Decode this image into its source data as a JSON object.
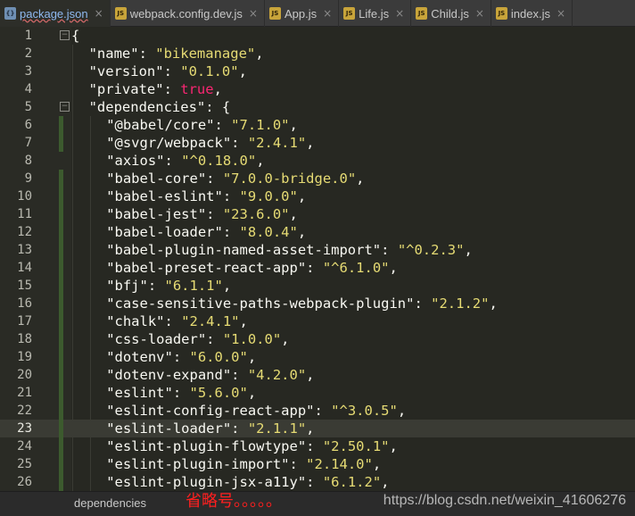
{
  "tabs": [
    {
      "label": "package.json",
      "icon": "json-file-icon",
      "glyph": "{}",
      "active": true,
      "close": "×"
    },
    {
      "label": "webpack.config.dev.js",
      "icon": "js-file-icon",
      "glyph": "JS",
      "active": false,
      "close": "×"
    },
    {
      "label": "App.js",
      "icon": "js-file-icon",
      "glyph": "JS",
      "active": false,
      "close": "×"
    },
    {
      "label": "Life.js",
      "icon": "js-file-icon",
      "glyph": "JS",
      "active": false,
      "close": "×"
    },
    {
      "label": "Child.js",
      "icon": "js-file-icon",
      "glyph": "JS",
      "active": false,
      "close": "×"
    },
    {
      "label": "index.js",
      "icon": "js-file-icon",
      "glyph": "JS",
      "active": false,
      "close": "×"
    }
  ],
  "editor": {
    "current_line": 23,
    "lines": [
      {
        "n": "1",
        "indent": 0,
        "parts": [
          [
            "k",
            "{"
          ]
        ]
      },
      {
        "n": "2",
        "indent": 1,
        "parts": [
          [
            "k",
            "\"name\": "
          ],
          [
            "s",
            "\"bikemanage\""
          ],
          [
            "k",
            ","
          ]
        ]
      },
      {
        "n": "3",
        "indent": 1,
        "parts": [
          [
            "k",
            "\"version\": "
          ],
          [
            "s",
            "\"0.1.0\""
          ],
          [
            "k",
            ","
          ]
        ]
      },
      {
        "n": "4",
        "indent": 1,
        "parts": [
          [
            "k",
            "\"private\": "
          ],
          [
            "t",
            "true"
          ],
          [
            "k",
            ","
          ]
        ]
      },
      {
        "n": "5",
        "indent": 1,
        "parts": [
          [
            "k",
            "\"dependencies\": {"
          ]
        ]
      },
      {
        "n": "6",
        "indent": 2,
        "parts": [
          [
            "k",
            "\"@babel/core\": "
          ],
          [
            "s",
            "\"7.1.0\""
          ],
          [
            "k",
            ","
          ]
        ]
      },
      {
        "n": "7",
        "indent": 2,
        "parts": [
          [
            "k",
            "\"@svgr/webpack\": "
          ],
          [
            "s",
            "\"2.4.1\""
          ],
          [
            "k",
            ","
          ]
        ]
      },
      {
        "n": "8",
        "indent": 2,
        "parts": [
          [
            "k",
            "\"axios\": "
          ],
          [
            "s",
            "\"^0.18.0\""
          ],
          [
            "k",
            ","
          ]
        ]
      },
      {
        "n": "9",
        "indent": 2,
        "parts": [
          [
            "k",
            "\"babel-core\": "
          ],
          [
            "s",
            "\"7.0.0-bridge.0\""
          ],
          [
            "k",
            ","
          ]
        ]
      },
      {
        "n": "10",
        "indent": 2,
        "parts": [
          [
            "k",
            "\"babel-eslint\": "
          ],
          [
            "s",
            "\"9.0.0\""
          ],
          [
            "k",
            ","
          ]
        ]
      },
      {
        "n": "11",
        "indent": 2,
        "parts": [
          [
            "k",
            "\"babel-jest\": "
          ],
          [
            "s",
            "\"23.6.0\""
          ],
          [
            "k",
            ","
          ]
        ]
      },
      {
        "n": "12",
        "indent": 2,
        "parts": [
          [
            "k",
            "\"babel-loader\": "
          ],
          [
            "s",
            "\"8.0.4\""
          ],
          [
            "k",
            ","
          ]
        ]
      },
      {
        "n": "13",
        "indent": 2,
        "parts": [
          [
            "k",
            "\"babel-plugin-named-asset-import\": "
          ],
          [
            "s",
            "\"^0.2.3\""
          ],
          [
            "k",
            ","
          ]
        ]
      },
      {
        "n": "14",
        "indent": 2,
        "parts": [
          [
            "k",
            "\"babel-preset-react-app\": "
          ],
          [
            "s",
            "\"^6.1.0\""
          ],
          [
            "k",
            ","
          ]
        ]
      },
      {
        "n": "15",
        "indent": 2,
        "parts": [
          [
            "k",
            "\"bfj\": "
          ],
          [
            "s",
            "\"6.1.1\""
          ],
          [
            "k",
            ","
          ]
        ]
      },
      {
        "n": "16",
        "indent": 2,
        "parts": [
          [
            "k",
            "\"case-sensitive-paths-webpack-plugin\": "
          ],
          [
            "s",
            "\"2.1.2\""
          ],
          [
            "k",
            ","
          ]
        ]
      },
      {
        "n": "17",
        "indent": 2,
        "parts": [
          [
            "k",
            "\"chalk\": "
          ],
          [
            "s",
            "\"2.4.1\""
          ],
          [
            "k",
            ","
          ]
        ]
      },
      {
        "n": "18",
        "indent": 2,
        "parts": [
          [
            "k",
            "\"css-loader\": "
          ],
          [
            "s",
            "\"1.0.0\""
          ],
          [
            "k",
            ","
          ]
        ]
      },
      {
        "n": "19",
        "indent": 2,
        "parts": [
          [
            "k",
            "\"dotenv\": "
          ],
          [
            "s",
            "\"6.0.0\""
          ],
          [
            "k",
            ","
          ]
        ]
      },
      {
        "n": "20",
        "indent": 2,
        "parts": [
          [
            "k",
            "\"dotenv-expand\": "
          ],
          [
            "s",
            "\"4.2.0\""
          ],
          [
            "k",
            ","
          ]
        ]
      },
      {
        "n": "21",
        "indent": 2,
        "parts": [
          [
            "k",
            "\"eslint\": "
          ],
          [
            "s",
            "\"5.6.0\""
          ],
          [
            "k",
            ","
          ]
        ]
      },
      {
        "n": "22",
        "indent": 2,
        "parts": [
          [
            "k",
            "\"eslint-config-react-app\": "
          ],
          [
            "s",
            "\"^3.0.5\""
          ],
          [
            "k",
            ","
          ]
        ]
      },
      {
        "n": "23",
        "indent": 2,
        "parts": [
          [
            "k",
            "\"eslint-loader\": "
          ],
          [
            "s",
            "\"2.1.1\""
          ],
          [
            "k",
            ","
          ]
        ]
      },
      {
        "n": "24",
        "indent": 2,
        "parts": [
          [
            "k",
            "\"eslint-plugin-flowtype\": "
          ],
          [
            "s",
            "\"2.50.1\""
          ],
          [
            "k",
            ","
          ]
        ]
      },
      {
        "n": "25",
        "indent": 2,
        "parts": [
          [
            "k",
            "\"eslint-plugin-import\": "
          ],
          [
            "s",
            "\"2.14.0\""
          ],
          [
            "k",
            ","
          ]
        ]
      },
      {
        "n": "26",
        "indent": 2,
        "parts": [
          [
            "k",
            "\"eslint-plugin-jsx-a11y\": "
          ],
          [
            "s",
            "\"6.1.2\""
          ],
          [
            "k",
            ","
          ]
        ]
      }
    ]
  },
  "statusbar": {
    "breadcrumb": "dependencies",
    "note": "省略号。。。。。",
    "watermark": "https://blog.csdn.net/weixin_41606276"
  },
  "colors": {
    "background": "#272822",
    "string": "#e6db74",
    "keyword": "#f92672",
    "text": "#f8f8f2",
    "note": "#ff1f1f"
  }
}
